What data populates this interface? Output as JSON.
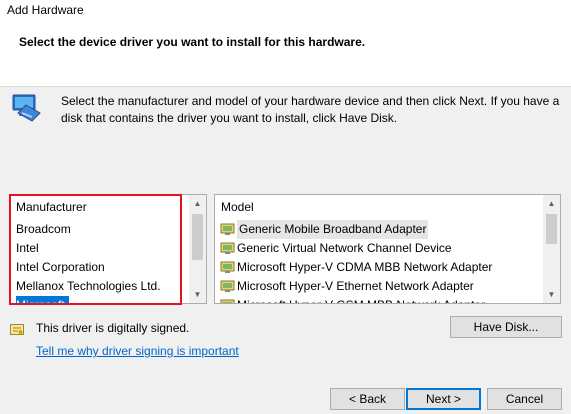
{
  "window": {
    "title": "Add Hardware",
    "heading": "Select the device driver you want to install for this hardware."
  },
  "instructions": "Select the manufacturer and model of your hardware device and then click Next. If you have a disk that contains the driver you want to install, click Have Disk.",
  "manufacturer_list": {
    "header": "Manufacturer",
    "items": [
      "Broadcom",
      "Intel",
      "Intel Corporation",
      "Mellanox Technologies Ltd.",
      "Microsoft"
    ],
    "selected": "Microsoft"
  },
  "model_list": {
    "header": "Model",
    "items": [
      "Generic Mobile Broadband Adapter",
      "Generic Virtual Network Channel Device",
      "Microsoft Hyper-V CDMA MBB Network Adapter",
      "Microsoft Hyper-V Ethernet Network Adapter",
      "Microsoft Hyper-V GSM MBB Network Adapter"
    ],
    "selected": "Generic Mobile Broadband Adapter"
  },
  "signing": {
    "status": "This driver is digitally signed.",
    "link": "Tell me why driver signing is important"
  },
  "buttons": {
    "have_disk": "Have Disk...",
    "back": "< Back",
    "next": "Next >",
    "cancel": "Cancel"
  },
  "colors": {
    "selection": "#0078d7",
    "highlight_border": "#e81123",
    "link": "#0066cc"
  },
  "icons": {
    "hardware": "hardware-wizard-icon",
    "driver": "driver-icon",
    "signed": "certificate-icon"
  }
}
